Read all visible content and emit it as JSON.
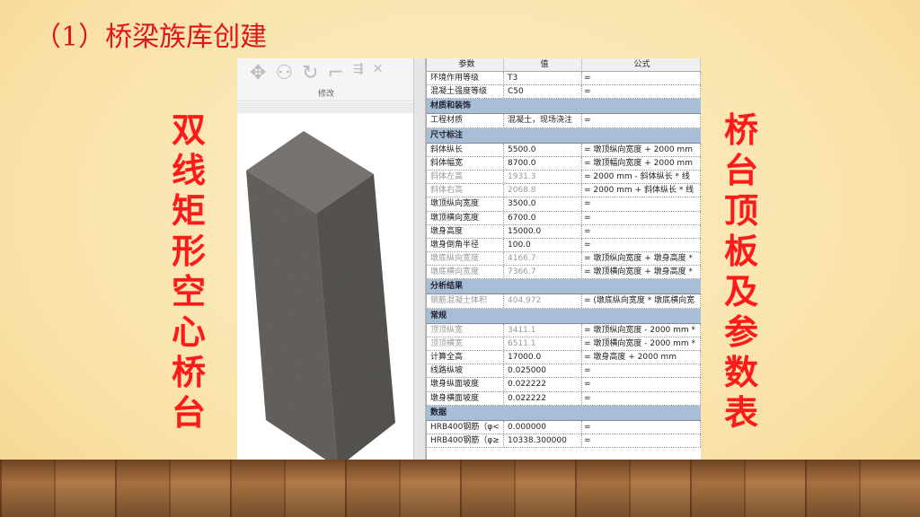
{
  "slide": {
    "title": "（1）桥梁族库创建",
    "left_label": "双线矩形空心桥台",
    "right_label": "桥台顶板及参数表"
  },
  "toolbar": {
    "group_label": "修改",
    "icons": [
      "move-icon",
      "copy-icon",
      "rotate-icon",
      "trim-icon",
      "align-icon",
      "delete-icon"
    ]
  },
  "table": {
    "headers": [
      "参数",
      "值",
      "公式"
    ],
    "sections": [
      {
        "group": null,
        "rows": [
          {
            "name": "环境作用等级",
            "value": "T3",
            "formula": "=",
            "dim": false
          },
          {
            "name": "混凝土强度等级",
            "value": "C50",
            "formula": "=",
            "dim": false
          }
        ]
      },
      {
        "group": "材质和装饰",
        "rows": [
          {
            "name": "工程材质",
            "value": "混凝土，现场浇注",
            "formula": "=",
            "dim": false
          }
        ]
      },
      {
        "group": "尺寸标注",
        "rows": [
          {
            "name": "斜体纵长",
            "value": "5500.0",
            "formula": "= 墩顶纵向宽度 + 2000 mm",
            "dim": false
          },
          {
            "name": "斜体幅宽",
            "value": "8700.0",
            "formula": "= 墩顶幅向宽度 + 2000 mm",
            "dim": false
          },
          {
            "name": "斜体左高",
            "value": "1931.3",
            "formula": "= 2000 mm - 斜体纵长 * 线",
            "dim": true
          },
          {
            "name": "斜体右高",
            "value": "2068.8",
            "formula": "= 2000 mm + 斜体纵长 * 线",
            "dim": true
          },
          {
            "name": "墩顶纵向宽度",
            "value": "3500.0",
            "formula": "=",
            "dim": false
          },
          {
            "name": "墩顶横向宽度",
            "value": "6700.0",
            "formula": "=",
            "dim": false
          },
          {
            "name": "墩身高度",
            "value": "15000.0",
            "formula": "=",
            "dim": false
          },
          {
            "name": "墩身倒角半径",
            "value": "100.0",
            "formula": "=",
            "dim": false
          },
          {
            "name": "墩底纵向宽度",
            "value": "4166.7",
            "formula": "= 墩顶纵向宽度 + 墩身高度 *",
            "dim": true
          },
          {
            "name": "墩底横向宽度",
            "value": "7366.7",
            "formula": "= 墩顶横向宽度 + 墩身高度 *",
            "dim": true
          }
        ]
      },
      {
        "group": "分析结果",
        "rows": [
          {
            "name": "钢筋混凝土体积",
            "value": "404.972",
            "formula": "= (墩底纵向宽度 * 墩底横向宽",
            "dim": true
          }
        ]
      },
      {
        "group": "常规",
        "rows": [
          {
            "name": "顶顶纵宽",
            "value": "3411.1",
            "formula": "= 墩顶纵向宽度 - 2000 mm *",
            "dim": true
          },
          {
            "name": "顶顶横宽",
            "value": "6511.1",
            "formula": "= 墩顶横向宽度 - 2000 mm *",
            "dim": true
          },
          {
            "name": "计算全高",
            "value": "17000.0",
            "formula": "= 墩身高度 + 2000 mm",
            "dim": false
          },
          {
            "name": "线路纵坡",
            "value": "0.025000",
            "formula": "=",
            "dim": false
          },
          {
            "name": "墩身纵面坡度",
            "value": "0.022222",
            "formula": "=",
            "dim": false
          },
          {
            "name": "墩身横面坡度",
            "value": "0.022222",
            "formula": "=",
            "dim": false
          }
        ]
      },
      {
        "group": "数据",
        "rows": [
          {
            "name": "HRB400钢筋（φ<",
            "value": "0.000000",
            "formula": "=",
            "dim": false
          },
          {
            "name": "HRB400钢筋（φ≥",
            "value": "10338.300000",
            "formula": "=",
            "dim": false
          }
        ]
      }
    ]
  }
}
